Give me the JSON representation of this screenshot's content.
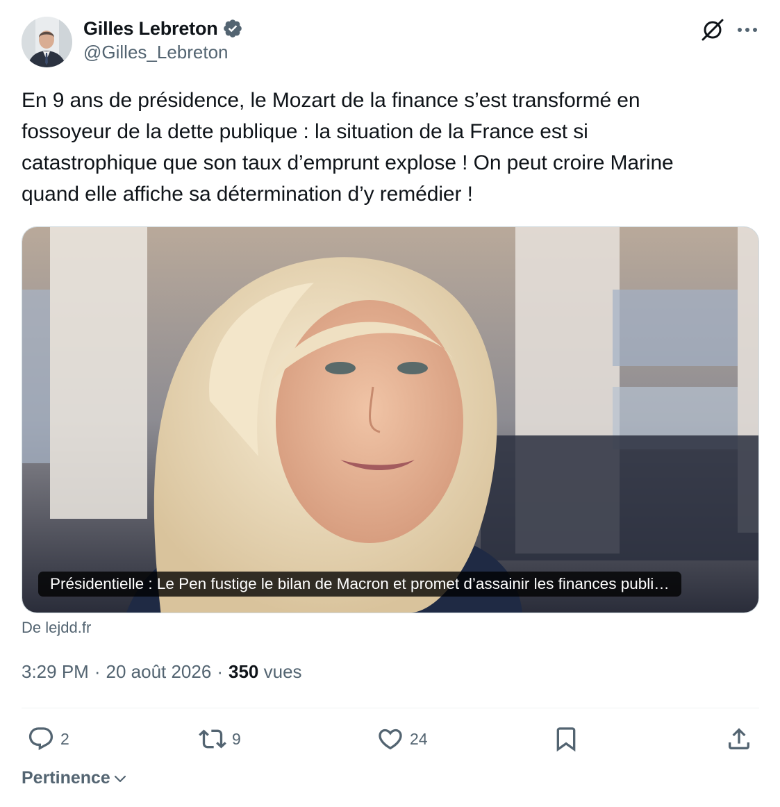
{
  "author": {
    "name": "Gilles Lebreton",
    "handle": "@Gilles_Lebreton",
    "verified_color": "#536471"
  },
  "tweet_text": "En 9 ans de présidence, le Mozart de la finance s’est transformé en\nfossoyeur de la dette publique : la situation de la France est si\ncatastrophique que son taux d’emprunt explose ! On peut croire Marine\nquand elle affiche sa détermination d’y remédier !",
  "card": {
    "title": "Présidentielle : Le Pen fustige le bilan de Macron et promet d’assainir les finances publi…",
    "source": "De lejdd.fr",
    "image": "photo of a smiling woman with blonde hair"
  },
  "meta": {
    "time": "3:29 PM",
    "date": "20 août 2026",
    "separator": "·",
    "views_count": "350",
    "views_label": "vues"
  },
  "actions": {
    "replies": "2",
    "retweets": "9",
    "likes": "24"
  },
  "sort": {
    "label": "Pertinence"
  },
  "icons": {
    "grok": "grok-icon",
    "more": "more-icon",
    "reply": "reply-icon",
    "retweet": "retweet-icon",
    "like": "heart-icon",
    "bookmark": "bookmark-icon",
    "share": "share-icon",
    "chevron": "chevron-down-icon"
  },
  "colors": {
    "text": "#0f1419",
    "secondary": "#536471",
    "border": "#cfd9de"
  }
}
